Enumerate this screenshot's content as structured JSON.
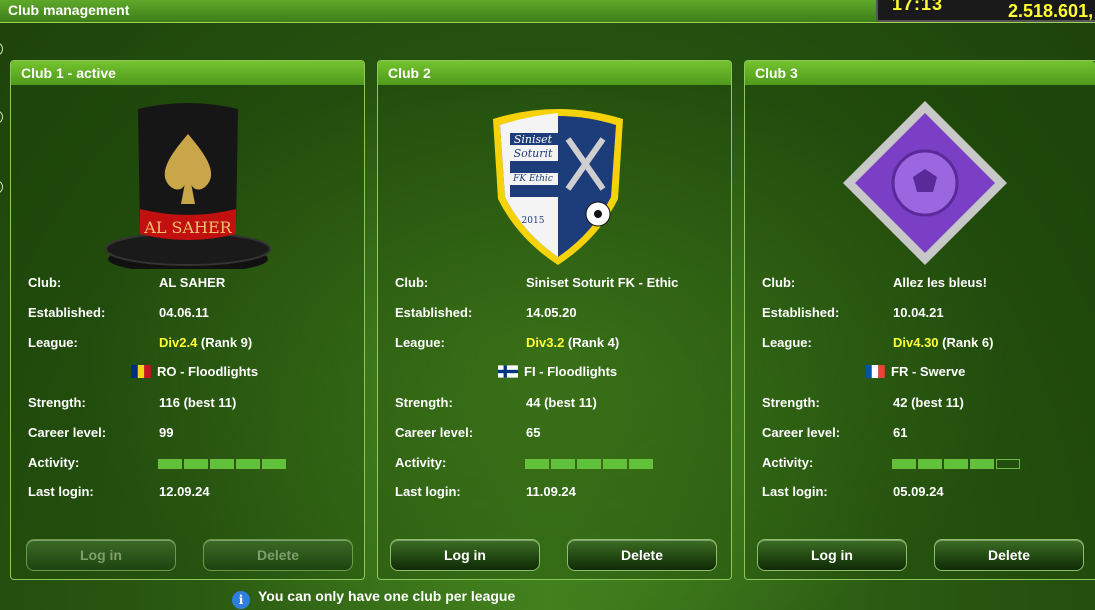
{
  "window": {
    "title": "Club management"
  },
  "status": {
    "time": "17:13",
    "money": "2.518.601,"
  },
  "labels": {
    "club": "Club:",
    "established": "Established:",
    "league": "League:",
    "strength": "Strength:",
    "career": "Career level:",
    "activity": "Activity:",
    "last_login": "Last login:"
  },
  "colors": {
    "accent": "#ffff33",
    "panel_head": "#5fae22"
  },
  "clubs": [
    {
      "title": "Club 1 - active",
      "name": "AL SAHER",
      "established": "04.06.11",
      "league_div": "Div2.4",
      "league_rank": " (Rank 9)",
      "country": "RO - Floodlights",
      "strength": "116 (best 11)",
      "career": "99",
      "activity": 5,
      "last_login": "12.09.24",
      "login_label": "Log in",
      "delete_label": "Delete",
      "login_enabled": false,
      "logo_text": "AL SAHER"
    },
    {
      "title": "Club 2",
      "name": "Siniset Soturit FK - Ethic",
      "established": "14.05.20",
      "league_div": "Div3.2",
      "league_rank": " (Rank 4)",
      "country": "FI - Floodlights",
      "strength": "44 (best 11)",
      "career": "65",
      "activity": 5,
      "last_login": "11.09.24",
      "login_label": "Log in",
      "delete_label": "Delete",
      "login_enabled": true,
      "logo_lines": [
        "Siniset",
        "Soturit",
        "FK Ethic",
        "2015"
      ]
    },
    {
      "title": "Club 3",
      "name": "Allez les bleus!",
      "established": "10.04.21",
      "league_div": "Div4.30",
      "league_rank": " (Rank 6)",
      "country": "FR - Swerve",
      "strength": "42 (best 11)",
      "career": "61",
      "activity": 4,
      "last_login": "05.09.24",
      "login_label": "Log in",
      "delete_label": "Delete",
      "login_enabled": true
    }
  ],
  "footer": {
    "info": "You can only have one club per league",
    "info_icon": "info-icon"
  }
}
